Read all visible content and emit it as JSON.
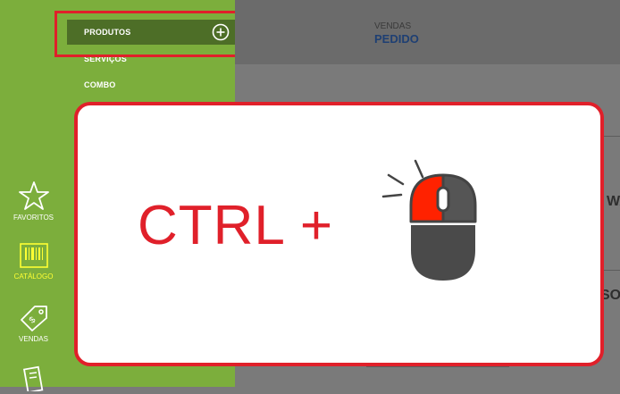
{
  "sidebar": {
    "rail_items": [
      {
        "label": "FAVORITOS",
        "icon": "star-icon"
      },
      {
        "label": "CATÁLOGO",
        "icon": "barcode-catalog-icon",
        "active": true
      },
      {
        "label": "VENDAS",
        "icon": "price-tag-icon"
      },
      {
        "label": "",
        "icon": "receipt-icon"
      }
    ],
    "submenu": [
      {
        "label": "PRODUTOS",
        "active": true,
        "icon": "plus-circle-icon"
      },
      {
        "label": "SERVIÇOS"
      },
      {
        "label": "COMBO"
      }
    ]
  },
  "header": {
    "eyebrow": "VENDAS",
    "title": "PEDIDO"
  },
  "background_peek": {
    "right_text_1": "WA",
    "right_text_2": "SO"
  },
  "overlay": {
    "text": "CTRL +",
    "icon": "mouse-left-click-icon"
  },
  "colors": {
    "sidebar_green": "#7cae3c",
    "active_item_green": "#4d6e27",
    "accent_red": "#e0202a",
    "active_yellow": "#ffff33",
    "header_title_blue": "#1e3f73"
  }
}
